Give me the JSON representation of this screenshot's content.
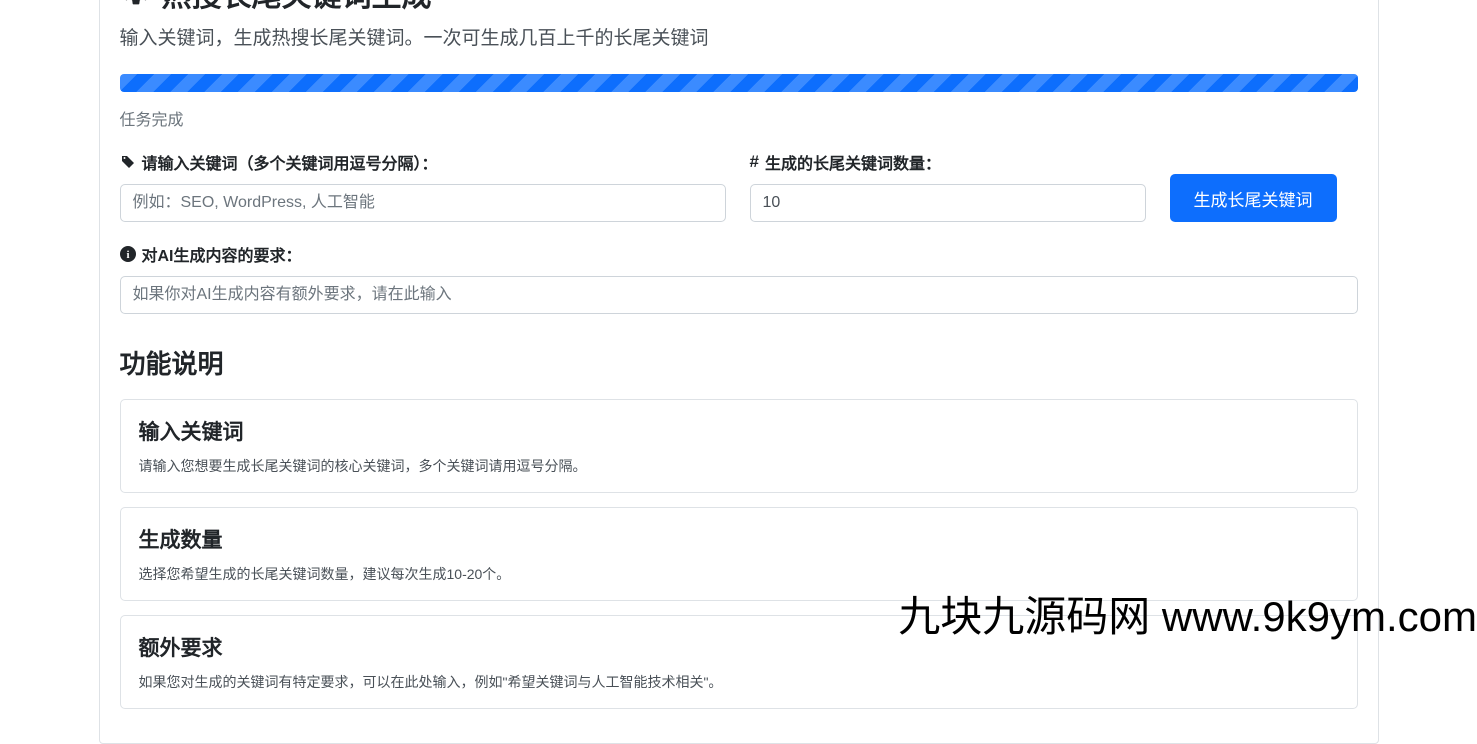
{
  "header": {
    "title": "热搜长尾关键词生成",
    "subtitle": "输入关键词，生成热搜长尾关键词。一次可生成几百上千的长尾关键词"
  },
  "status": {
    "text": "任务完成"
  },
  "form": {
    "keyword": {
      "label": "请输入关键词（多个关键词用逗号分隔）：",
      "placeholder": "例如：SEO, WordPress, 人工智能",
      "value": ""
    },
    "count": {
      "label": "生成的长尾关键词数量：",
      "value": "10"
    },
    "requirement": {
      "label": "对AI生成内容的要求：",
      "placeholder": "如果你对AI生成内容有额外要求，请在此输入",
      "value": ""
    },
    "submit_label": "生成长尾关键词"
  },
  "section": {
    "title": "功能说明",
    "cards": [
      {
        "title": "输入关键词",
        "desc": "请输入您想要生成长尾关键词的核心关键词，多个关键词请用逗号分隔。"
      },
      {
        "title": "生成数量",
        "desc": "选择您希望生成的长尾关键词数量，建议每次生成10-20个。"
      },
      {
        "title": "额外要求",
        "desc": "如果您对生成的关键词有特定要求，可以在此处输入，例如\"希望关键词与人工智能技术相关\"。"
      }
    ]
  },
  "watermark": "九块九源码网 www.9k9ym.com"
}
